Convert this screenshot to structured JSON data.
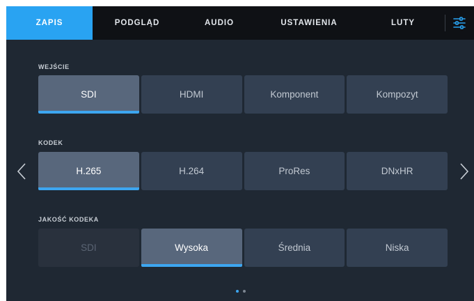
{
  "tabs": [
    {
      "label": "ZAPIS",
      "active": true
    },
    {
      "label": "PODGLĄD",
      "active": false
    },
    {
      "label": "AUDIO",
      "active": false
    },
    {
      "label": "USTAWIENIA",
      "active": false
    },
    {
      "label": "LUTY",
      "active": false
    }
  ],
  "settings_icon": "sliders-icon",
  "sections": {
    "input": {
      "label": "WEJŚCIE",
      "options": [
        "SDI",
        "HDMI",
        "Komponent",
        "Kompozyt"
      ],
      "selected": "SDI"
    },
    "codec": {
      "label": "KODEK",
      "options": [
        "H.265",
        "H.264",
        "ProRes",
        "DNxHR"
      ],
      "selected": "H.265"
    },
    "quality": {
      "label": "JAKOŚĆ KODEKA",
      "options": [
        "SDI",
        "Wysoka",
        "Średnia",
        "Niska"
      ],
      "selected": "Wysoka",
      "disabled": [
        "SDI"
      ]
    }
  },
  "pagination": {
    "pages": 2,
    "current": 1
  },
  "colors": {
    "accent": "#29a3f2",
    "background": "#1f2833",
    "tabbar": "#0f1115",
    "option": "#334052",
    "option_selected": "#58677c"
  }
}
